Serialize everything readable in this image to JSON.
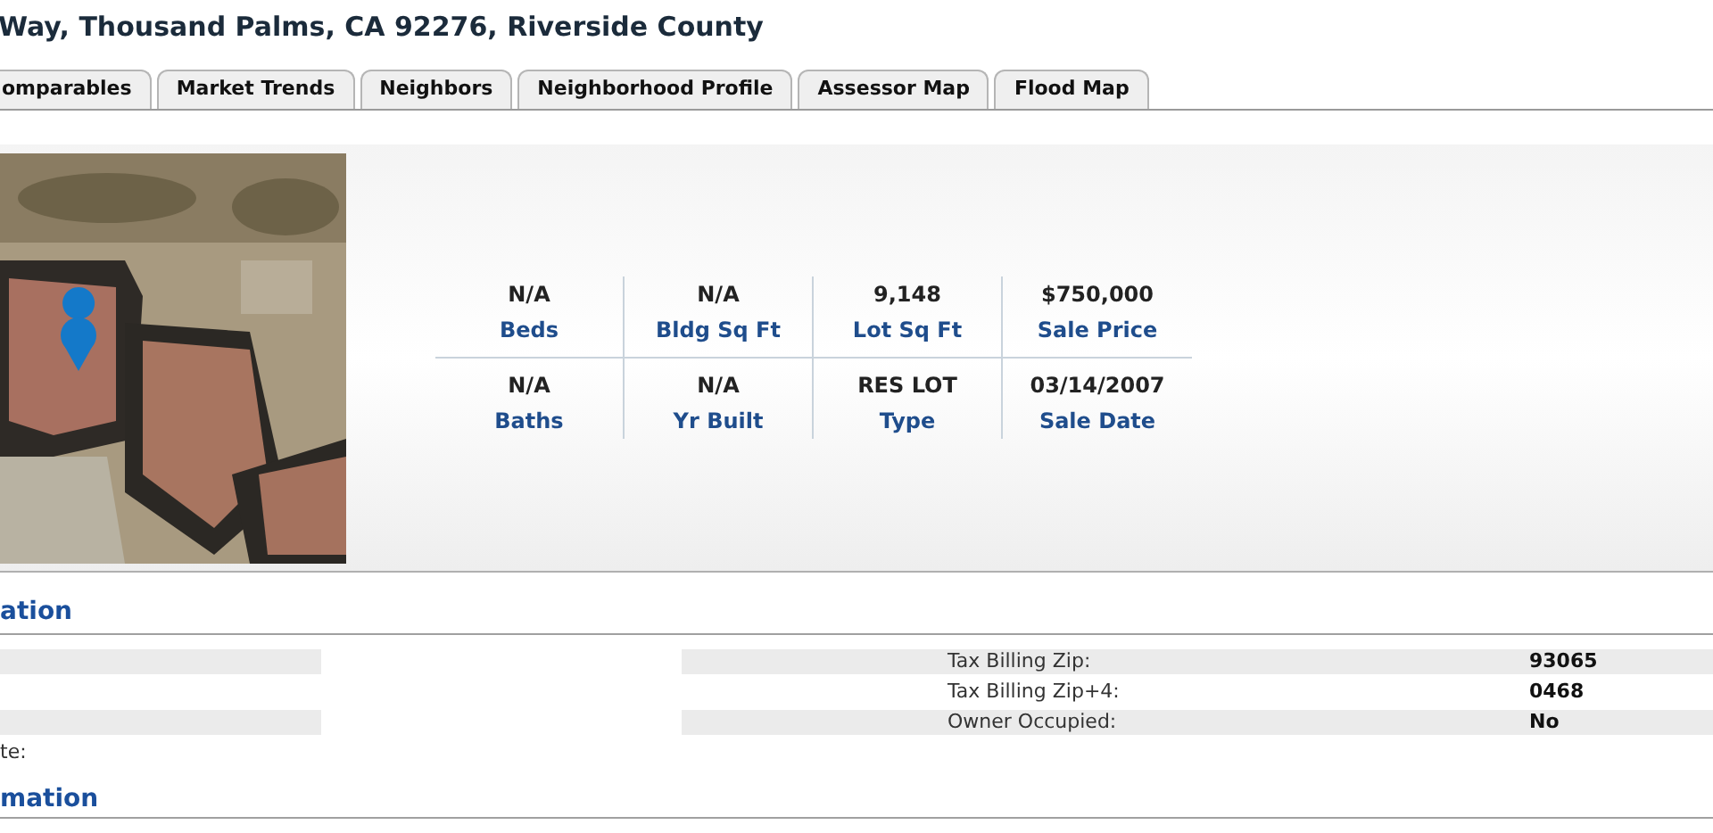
{
  "title": "Way, Thousand Palms, CA 92276, Riverside County",
  "tabs": [
    {
      "label": "omparables"
    },
    {
      "label": "Market Trends"
    },
    {
      "label": "Neighbors"
    },
    {
      "label": "Neighborhood Profile"
    },
    {
      "label": "Assessor Map"
    },
    {
      "label": "Flood Map"
    }
  ],
  "summary": {
    "stats": [
      {
        "value": "N/A",
        "label": "Beds"
      },
      {
        "value": "N/A",
        "label": "Bldg Sq Ft"
      },
      {
        "value": "9,148",
        "label": "Lot Sq Ft"
      },
      {
        "value": "$750,000",
        "label": "Sale Price"
      },
      {
        "value": "N/A",
        "label": "Baths"
      },
      {
        "value": "N/A",
        "label": "Yr Built"
      },
      {
        "value": "RES LOT",
        "label": "Type"
      },
      {
        "value": "03/14/2007",
        "label": "Sale Date"
      }
    ]
  },
  "section_1": {
    "heading": "ation",
    "rows": [
      {
        "label": "Tax Billing Zip:",
        "value": "93065"
      },
      {
        "label": "Tax Billing Zip+4:",
        "value": "0468"
      },
      {
        "label": "Owner Occupied:",
        "value": "No"
      }
    ],
    "left_label": "te:"
  },
  "section_2": {
    "heading": "mation"
  }
}
